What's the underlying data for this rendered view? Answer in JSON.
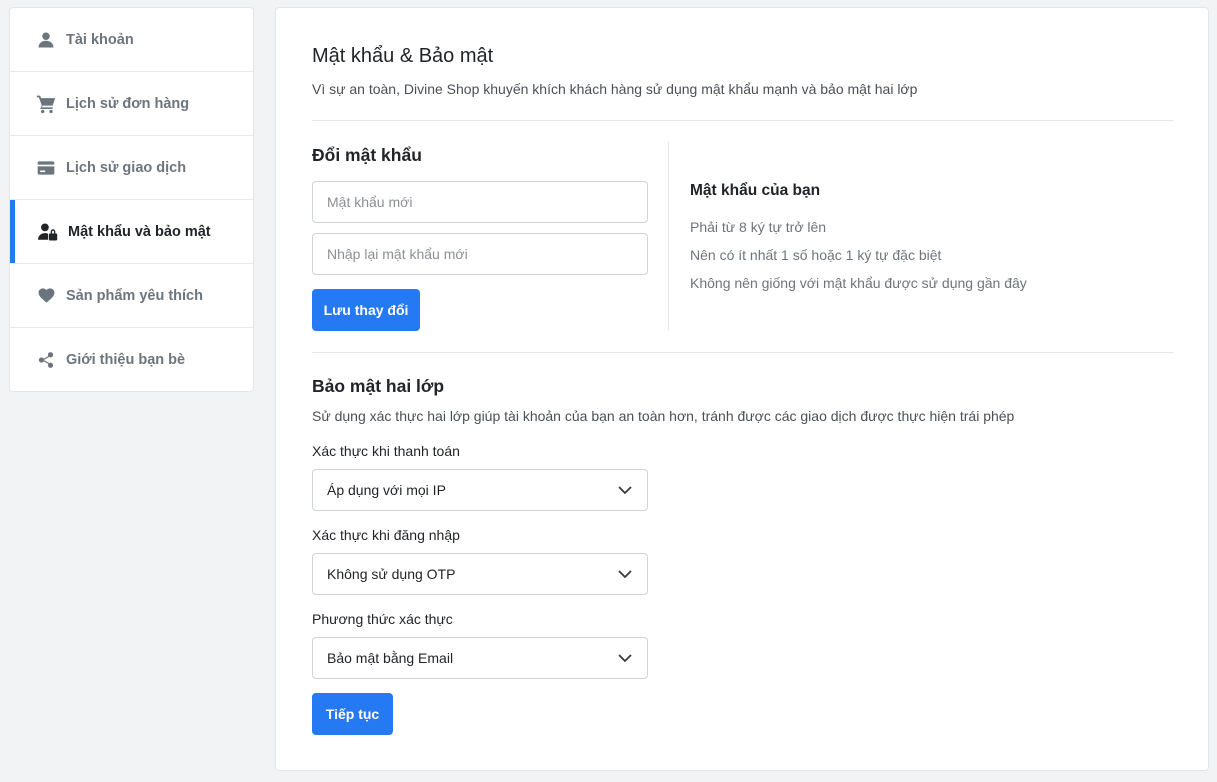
{
  "sidebar": {
    "items": [
      {
        "label": "Tài khoản",
        "icon": "user-icon",
        "active": false
      },
      {
        "label": "Lịch sử đơn hàng",
        "icon": "cart-icon",
        "active": false
      },
      {
        "label": "Lịch sử giao dịch",
        "icon": "credit-card-icon",
        "active": false
      },
      {
        "label": "Mật khẩu và bảo mật",
        "icon": "user-lock-icon",
        "active": true
      },
      {
        "label": "Sản phẩm yêu thích",
        "icon": "heart-icon",
        "active": false
      },
      {
        "label": "Giới thiệu bạn bè",
        "icon": "share-icon",
        "active": false
      }
    ]
  },
  "main": {
    "title": "Mật khẩu & Bảo mật",
    "subtitle": "Vì sự an toàn, Divine Shop khuyến khích khách hàng sử dụng mật khẩu mạnh và bảo mật hai lớp",
    "change_password": {
      "title": "Đổi mật khẩu",
      "new_password_placeholder": "Mật khẩu mới",
      "confirm_password_placeholder": "Nhập lại mật khẩu mới",
      "save_label": "Lưu thay đổi"
    },
    "requirements": {
      "title": "Mật khẩu của bạn",
      "items": [
        "Phải từ 8 ký tự trở lên",
        "Nên có ít nhất 1 số hoặc 1 ký tự đặc biệt",
        "Không nên giống với mật khẩu được sử dụng gần đây"
      ]
    },
    "two_factor": {
      "title": "Bảo mật hai lớp",
      "description": "Sử dụng xác thực hai lớp giúp tài khoản của bạn an toàn hơn, tránh được các giao dịch được thực hiện trái phép",
      "fields": [
        {
          "label": "Xác thực khi thanh toán",
          "value": "Áp dụng với mọi IP"
        },
        {
          "label": "Xác thực khi đăng nhập",
          "value": "Không sử dụng OTP"
        },
        {
          "label": "Phương thức xác thực",
          "value": "Bảo mật bằng Email"
        }
      ],
      "continue_label": "Tiếp tục"
    }
  },
  "colors": {
    "accent": "#2579f2",
    "background": "#f2f3f5",
    "muted_text": "#6c757d"
  }
}
